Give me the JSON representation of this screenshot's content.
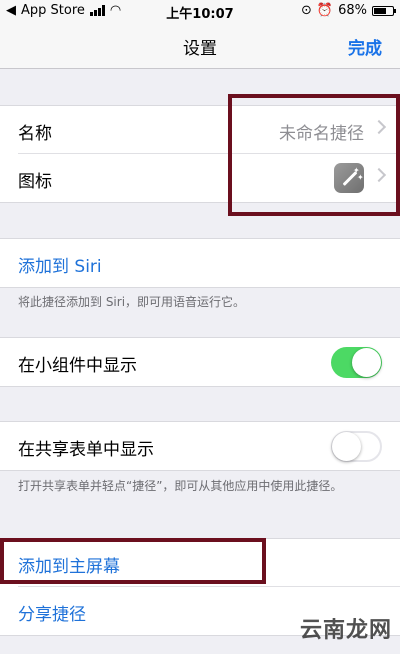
{
  "status_bar": {
    "carrier": "App Store",
    "time": "上午10:07",
    "battery_percent": "68%",
    "battery_level": 0.68
  },
  "nav": {
    "title": "设置",
    "done_label": "完成"
  },
  "group1": {
    "name_label": "名称",
    "name_value": "未命名捷径",
    "icon_label": "图标"
  },
  "siri": {
    "add_label": "添加到 Siri",
    "note": "将此捷径添加到 Siri，即可用语音运行它。"
  },
  "widget": {
    "label": "在小组件中显示",
    "enabled": true
  },
  "share_sheet": {
    "label": "在共享表单中显示",
    "enabled": false,
    "note": "打开共享表单并轻点“捷径”，即可从其他应用中使用此捷径。"
  },
  "actions": {
    "add_home": "添加到主屏幕",
    "share": "分享捷径"
  },
  "watermark": "云南龙网",
  "colors": {
    "accent": "#1f72d9",
    "toggle_on": "#4cd964",
    "highlight": "#6b0f1e"
  }
}
